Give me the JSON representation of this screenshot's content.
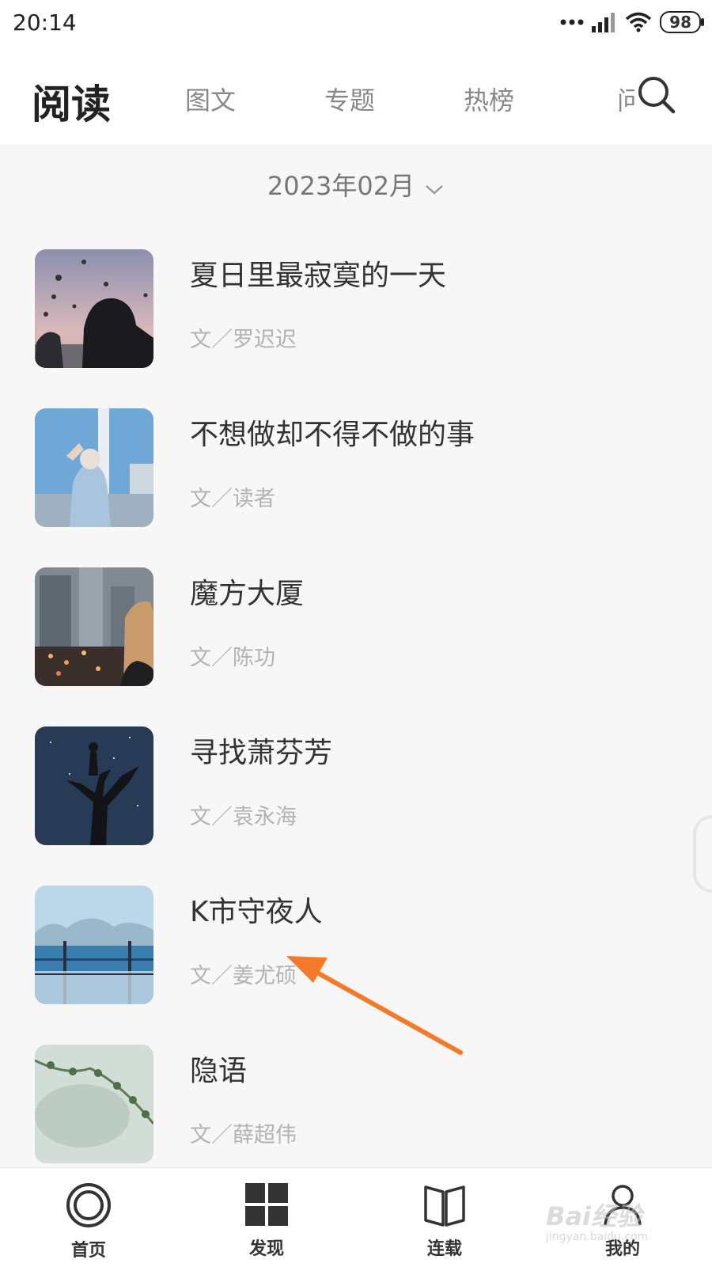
{
  "status_bar": {
    "time": "20:14",
    "battery": "98"
  },
  "header": {
    "title": "阅读",
    "tabs": [
      {
        "label": "图文"
      },
      {
        "label": "专题"
      },
      {
        "label": "热榜"
      },
      {
        "label": "问"
      }
    ]
  },
  "month_selector": {
    "label": "2023年02月"
  },
  "articles": [
    {
      "title": "夏日里最寂寞的一天",
      "author": "文／罗迟迟"
    },
    {
      "title": "不想做却不得不做的事",
      "author": "文／读者"
    },
    {
      "title": "魔方大厦",
      "author": "文／陈功"
    },
    {
      "title": "寻找萧芬芳",
      "author": "文／袁永海"
    },
    {
      "title": "K市守夜人",
      "author": "文／姜尤硕"
    },
    {
      "title": "隐语",
      "author": "文／薛超伟"
    }
  ],
  "bottom_nav": [
    {
      "label": "首页",
      "icon": "home-ring-icon"
    },
    {
      "label": "发现",
      "icon": "grid-icon"
    },
    {
      "label": "连载",
      "icon": "book-icon"
    },
    {
      "label": "我的",
      "icon": "user-icon"
    }
  ],
  "watermark": {
    "text": "Bai经验",
    "sub": "jingyan.baidu.com"
  },
  "colors": {
    "annotation_arrow": "#f47a2a",
    "text_primary": "#333333",
    "text_muted": "#b3b3b3"
  }
}
